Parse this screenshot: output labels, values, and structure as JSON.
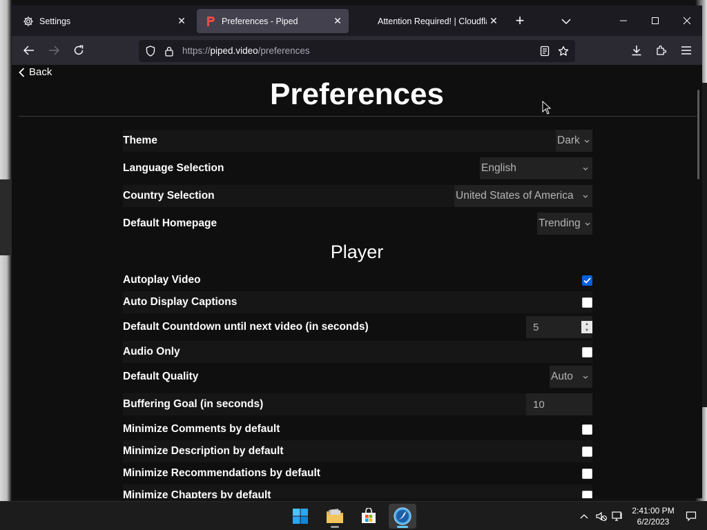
{
  "browser": {
    "tabs": [
      {
        "title": "Settings",
        "icon": "gear-icon",
        "active": false
      },
      {
        "title": "Preferences - Piped",
        "icon": "piped-favicon",
        "active": true
      },
      {
        "title": "Attention Required! | Cloudflare",
        "icon": "",
        "active": false
      }
    ],
    "url": {
      "prefix": "https://",
      "host": "piped.video",
      "path": "/preferences"
    }
  },
  "page": {
    "back_label": "Back",
    "title": "Preferences",
    "general": {
      "theme": {
        "label": "Theme",
        "value": "Dark"
      },
      "language": {
        "label": "Language Selection",
        "value": "English"
      },
      "country": {
        "label": "Country Selection",
        "value": "United States of America"
      },
      "homepage": {
        "label": "Default Homepage",
        "value": "Trending"
      }
    },
    "player_section_title": "Player",
    "player": {
      "autoplay": {
        "label": "Autoplay Video",
        "checked": true
      },
      "captions": {
        "label": "Auto Display Captions",
        "checked": false
      },
      "countdown": {
        "label": "Default Countdown until next video (in seconds)",
        "value": "5"
      },
      "audio_only": {
        "label": "Audio Only",
        "checked": false
      },
      "quality": {
        "label": "Default Quality",
        "value": "Auto"
      },
      "buffering": {
        "label": "Buffering Goal (in seconds)",
        "value": "10"
      },
      "min_comments": {
        "label": "Minimize Comments by default",
        "checked": false
      },
      "min_description": {
        "label": "Minimize Description by default",
        "checked": false
      },
      "min_recommendations": {
        "label": "Minimize Recommendations by default",
        "checked": false
      },
      "min_chapters": {
        "label": "Minimize Chapters by default",
        "checked": false
      }
    }
  },
  "taskbar": {
    "apps": [
      "windows-start-icon",
      "file-explorer-icon",
      "microsoft-store-icon",
      "browser-app-icon"
    ],
    "time": "2:41:00 PM",
    "date": "6/2/2023"
  },
  "colors": {
    "accent": "#0060df",
    "page_bg": "#0f0f0f",
    "row_shade": "#161616"
  }
}
